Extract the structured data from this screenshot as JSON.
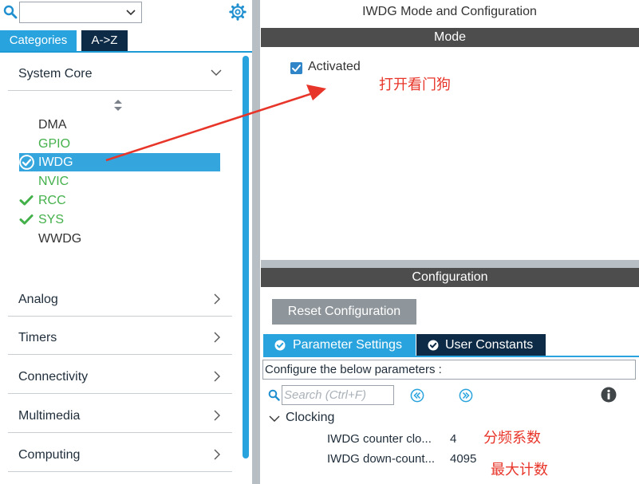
{
  "sidebar": {
    "search": {
      "value": ""
    },
    "tabs": [
      {
        "label": "Categories",
        "active": true
      },
      {
        "label": "A->Z",
        "active": false
      }
    ],
    "groups": {
      "system_core": {
        "label": "System Core",
        "expanded": true
      },
      "analog": {
        "label": "Analog"
      },
      "timers": {
        "label": "Timers"
      },
      "connectivity": {
        "label": "Connectivity"
      },
      "multimedia": {
        "label": "Multimedia"
      },
      "computing": {
        "label": "Computing"
      }
    },
    "peripherals": [
      {
        "label": "DMA",
        "status": "none"
      },
      {
        "label": "GPIO",
        "status": "configured"
      },
      {
        "label": "IWDG",
        "status": "selected-ok"
      },
      {
        "label": "NVIC",
        "status": "configured"
      },
      {
        "label": "RCC",
        "status": "ok"
      },
      {
        "label": "SYS",
        "status": "ok"
      },
      {
        "label": "WWDG",
        "status": "none"
      }
    ]
  },
  "main": {
    "title": "IWDG Mode and Configuration",
    "mode": {
      "header": "Mode",
      "activated_label": "Activated",
      "activated_checked": true
    },
    "configuration": {
      "header": "Configuration",
      "reset_button": "Reset Configuration",
      "tabs": [
        {
          "label": "Parameter Settings",
          "active": true
        },
        {
          "label": "User Constants",
          "active": false
        }
      ],
      "hint": "Configure the below parameters :",
      "search_placeholder": "Search (Ctrl+F)",
      "section": "Clocking",
      "params": [
        {
          "name": "IWDG counter clo...",
          "value": "4"
        },
        {
          "name": "IWDG down-count...",
          "value": "4095"
        }
      ]
    }
  },
  "annotations": {
    "open_watchdog": "打开看门狗",
    "prescaler": "分频系数",
    "max_count": "最大计数"
  },
  "colors": {
    "accent": "#29a3dd",
    "dark_navy": "#0d2a46",
    "bar_gray": "#4d4d4d",
    "ok_green": "#43b04a",
    "annotation_red": "#e8352a"
  }
}
